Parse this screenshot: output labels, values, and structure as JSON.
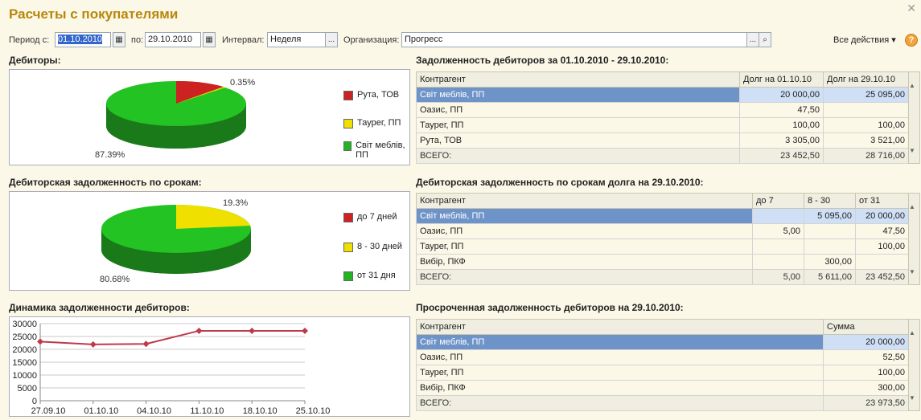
{
  "title": "Расчеты с покупателями",
  "toolbar": {
    "period_from_label": "Период с:",
    "period_from": "01.10.2010",
    "period_to_label": "по:",
    "period_to": "29.10.2010",
    "interval_label": "Интервал:",
    "interval": "Неделя",
    "org_label": "Организация:",
    "org": "Прогресс",
    "all_actions": "Все действия",
    "help": "?",
    "ellipsis": "...",
    "search_glyph": "🔍"
  },
  "debtors": {
    "title": "Дебиторы:",
    "pct_small": "0.35%",
    "pct_large": "87.39%",
    "legend": [
      {
        "label": "Рута, ТОВ",
        "color": "#cc2222"
      },
      {
        "label": "Таурег, ПП",
        "color": "#f0e000"
      },
      {
        "label": "Світ меблів, ПП",
        "color": "#22b522"
      }
    ]
  },
  "terms": {
    "title": "Дебиторская задолженность по срокам:",
    "pct_small": "19.3%",
    "pct_large": "80.68%",
    "legend": [
      {
        "label": "до 7 дней",
        "color": "#cc2222"
      },
      {
        "label": "8 - 30 дней",
        "color": "#f0e000"
      },
      {
        "label": "от 31 дня",
        "color": "#22b522"
      }
    ]
  },
  "dynamics": {
    "title": "Динамика задолженности дебиторов:"
  },
  "chart_data": {
    "type": "line",
    "title": "Динамика задолженности дебиторов:",
    "categories": [
      "27.09.10",
      "01.10.10",
      "04.10.10",
      "11.10.10",
      "18.10.10",
      "25.10.10"
    ],
    "series": [
      {
        "values": [
          23000,
          21900,
          22100,
          27200,
          27200,
          27200
        ]
      }
    ],
    "y_ticks": [
      "30000",
      "25000",
      "20000",
      "15000",
      "10000",
      "5000",
      "0"
    ],
    "ylim": [
      0,
      30000
    ],
    "grid": true,
    "color": "#c0394b"
  },
  "debt_table": {
    "title": "Задолженность дебиторов за 01.10.2010 - 29.10.2010:",
    "headers": [
      "Контрагент",
      "Долг на 01.10.10",
      "Долг на 29.10.10"
    ],
    "rows": [
      [
        "Світ меблів, ПП",
        "20 000,00",
        "25 095,00"
      ],
      [
        "Оазис, ПП",
        "47,50",
        ""
      ],
      [
        "Таурег, ПП",
        "100,00",
        "100,00"
      ],
      [
        "Рута, ТОВ",
        "3 305,00",
        "3 521,00"
      ]
    ],
    "total": [
      "ВСЕГО:",
      "23 452,50",
      "28 716,00"
    ]
  },
  "terms_table": {
    "title": "Дебиторская задолженность по срокам долга на 29.10.2010:",
    "headers": [
      "Контрагент",
      "до 7",
      "8 - 30",
      "от 31"
    ],
    "rows": [
      [
        "Світ меблів, ПП",
        "",
        "5 095,00",
        "20 000,00"
      ],
      [
        "Оазис, ПП",
        "5,00",
        "",
        "47,50"
      ],
      [
        "Таурег, ПП",
        "",
        "",
        "100,00"
      ],
      [
        "Вибір, ПКФ",
        "",
        "300,00",
        ""
      ]
    ],
    "total": [
      "ВСЕГО:",
      "5,00",
      "5 611,00",
      "23 452,50"
    ]
  },
  "overdue_table": {
    "title": "Просроченная задолженность дебиторов на 29.10.2010:",
    "headers": [
      "Контрагент",
      "Сумма"
    ],
    "rows": [
      [
        "Світ меблів, ПП",
        "20 000,00"
      ],
      [
        "Оазис, ПП",
        "52,50"
      ],
      [
        "Таурег, ПП",
        "100,00"
      ],
      [
        "Вибір, ПКФ",
        "300,00"
      ]
    ],
    "total": [
      "ВСЕГО:",
      "23 973,50"
    ]
  }
}
